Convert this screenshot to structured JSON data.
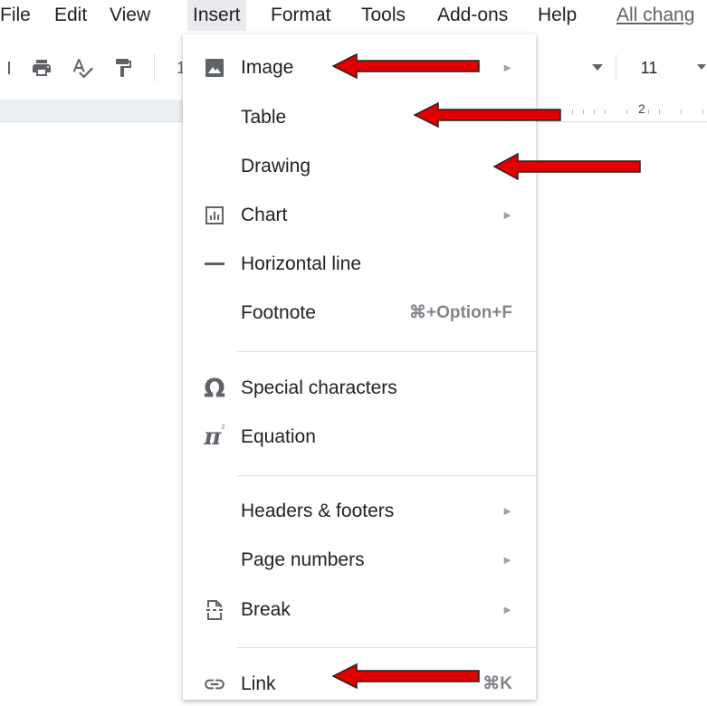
{
  "menubar": {
    "items": [
      "File",
      "Edit",
      "View",
      "Insert",
      "Format",
      "Tools",
      "Add-ons",
      "Help"
    ],
    "status_link": "All chang"
  },
  "toolbar": {
    "font_size": "11",
    "partial_digit": "1"
  },
  "ruler": {
    "number": "2"
  },
  "insert_menu": {
    "items": [
      {
        "label": "Image",
        "icon": "image-icon",
        "submenu": true
      },
      {
        "label": "Table",
        "icon": "",
        "submenu": true
      },
      {
        "label": "Drawing",
        "icon": "",
        "submenu": true
      },
      {
        "label": "Chart",
        "icon": "chart-icon",
        "submenu": true
      },
      {
        "label": "Horizontal line",
        "icon": "horizontal-line-icon",
        "submenu": false
      },
      {
        "label": "Footnote",
        "icon": "",
        "submenu": false,
        "shortcut": "⌘+Option+F"
      },
      {
        "label": "Special characters",
        "icon": "omega-icon",
        "submenu": false
      },
      {
        "label": "Equation",
        "icon": "pi-icon",
        "submenu": false
      },
      {
        "label": "Headers & footers",
        "icon": "",
        "submenu": true
      },
      {
        "label": "Page numbers",
        "icon": "",
        "submenu": true
      },
      {
        "label": "Break",
        "icon": "break-icon",
        "submenu": true
      },
      {
        "label": "Link",
        "icon": "link-icon",
        "submenu": false,
        "shortcut": "⌘K"
      }
    ],
    "submenu_glyph": "►"
  },
  "colors": {
    "annotation_arrow": "#e00000",
    "menu_icon": "#5f6368",
    "menu_text": "#202124"
  }
}
